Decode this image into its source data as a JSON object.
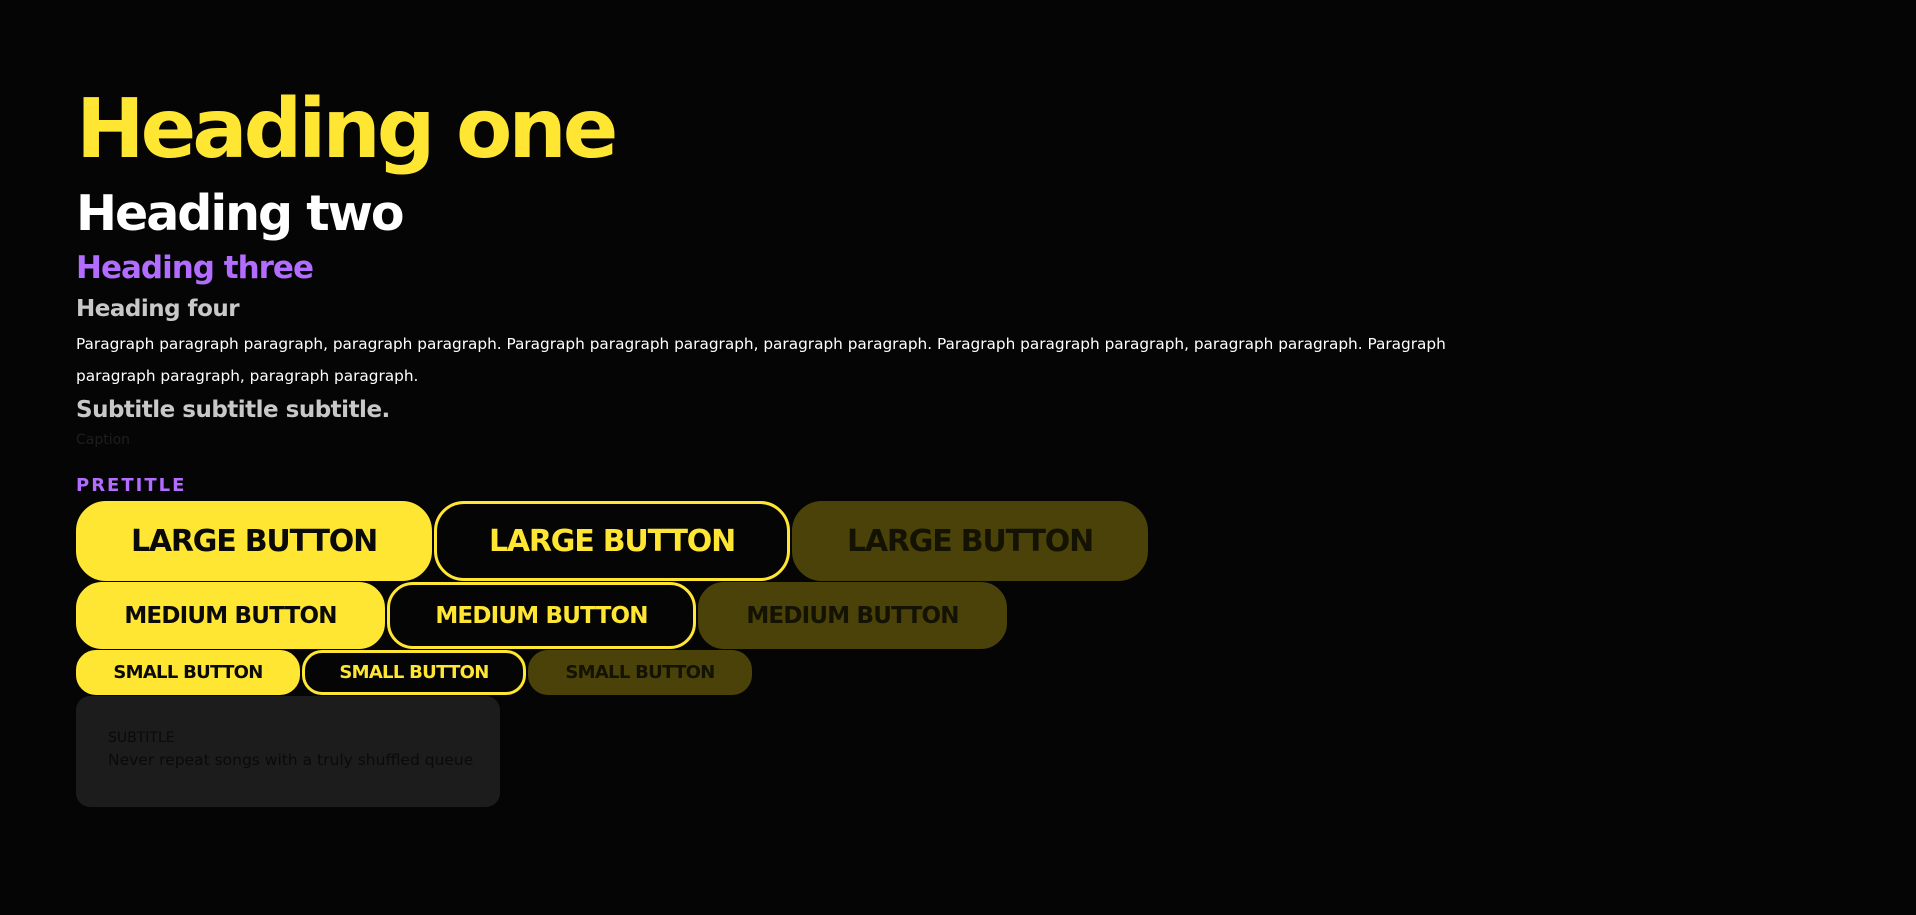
{
  "colors": {
    "background": "#050505",
    "accent_yellow": "#ffe633",
    "accent_purple": "#b26cff",
    "muted_yellow": "#4a4208",
    "card_background": "#1c1c1c"
  },
  "typography": {
    "heading_one": "Heading one",
    "heading_two": "Heading two",
    "heading_three": "Heading three",
    "heading_four": "Heading four",
    "paragraph": "Paragraph paragraph paragraph, paragraph paragraph. Paragraph paragraph paragraph, paragraph paragraph. Paragraph paragraph paragraph, paragraph paragraph. Paragraph paragraph paragraph, paragraph paragraph.",
    "subtitle": "Subtitle subtitle subtitle.",
    "caption": "Caption",
    "pretitle": "PRETITLE"
  },
  "buttons": {
    "large": {
      "primary": "LARGE BUTTON",
      "outline": "LARGE BUTTON",
      "muted": "LARGE BUTTON"
    },
    "medium": {
      "primary": "MEDIUM BUTTON",
      "outline": "MEDIUM BUTTON",
      "muted": "MEDIUM BUTTON"
    },
    "small": {
      "primary": "SMALL BUTTON",
      "outline": "SMALL BUTTON",
      "muted": "SMALL BUTTON"
    }
  },
  "card": {
    "subtitle": "SUBTITLE",
    "text": "Never repeat songs with a truly shuffled queue"
  }
}
